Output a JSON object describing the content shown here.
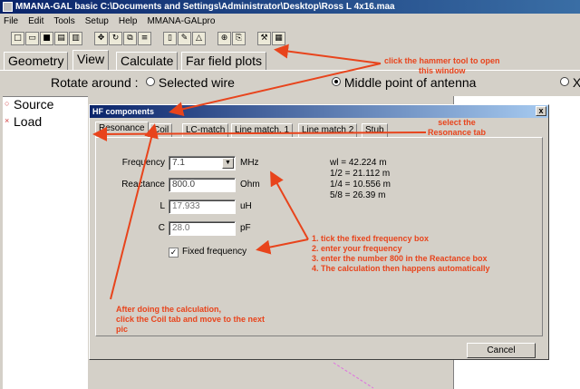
{
  "app": {
    "title": "MMANA-GAL basic C:\\Documents and Settings\\Administrator\\Desktop\\Ross L 4x16.maa"
  },
  "menu": [
    "File",
    "Edit",
    "Tools",
    "Setup",
    "Help",
    "MMANA-GALpro"
  ],
  "toolbar_icons": [
    "new-icon",
    "open-icon",
    "save-icon",
    "print-icon",
    "export-icon",
    "move-icon",
    "rotate-icon",
    "copy-icon",
    "align-icon",
    "page-icon",
    "edit-icon",
    "triangle-icon",
    "target-icon",
    "copy2-icon",
    "hammer-icon",
    "calculator-icon"
  ],
  "main_tabs": [
    "Geometry",
    "View",
    "Calculate",
    "Far field plots"
  ],
  "main_active_tab": "View",
  "rotate": {
    "label": "Rotate around :",
    "option1": "Selected wire",
    "option2": "Middle point of antenna",
    "option3": "X",
    "selected": "Middle point of antenna"
  },
  "tree": [
    "Source",
    "Load"
  ],
  "dialog": {
    "title": "HF components",
    "close": "x",
    "tabs": [
      "Resonance",
      "Coil",
      "LC-match",
      "Line match. 1",
      "Line match 2",
      "Stub"
    ],
    "active_tab": "Resonance",
    "frequency_label": "Frequency",
    "frequency_value": "7.1",
    "frequency_unit": "MHz",
    "reactance_label": "Reactance",
    "reactance_value": "800.0",
    "reactance_unit": "Ohm",
    "l_label": "L",
    "l_value": "17.933",
    "l_unit": "uH",
    "c_label": "C",
    "c_value": "28.0",
    "c_unit": "pF",
    "fixed_frequency_label": "Fixed frequency",
    "fixed_frequency_checked": true,
    "check_mark": "✓",
    "results": [
      "wl  = 42.224 m",
      "1/2 = 21.112 m",
      "1/4 = 10.556 m",
      "5/8 = 26.39 m"
    ],
    "cancel": "Cancel"
  },
  "annotations": {
    "hammer_note": [
      "click the hammer tool to open",
      "this window"
    ],
    "resonance_note": [
      "select the",
      "Resonance tab"
    ],
    "steps_note": [
      "1. tick the fixed frequency box",
      "2. enter your frequency",
      "3. enter the number 800 in the Reactance box",
      "4. The calculation then happens automatically"
    ],
    "coil_note": [
      "After doing the calculation,",
      "click the Coil tab and move to the next",
      "pic"
    ]
  },
  "colors": {
    "annotation": "#e8441c",
    "titlebar": "#0a246a",
    "face": "#d4d0c8"
  }
}
